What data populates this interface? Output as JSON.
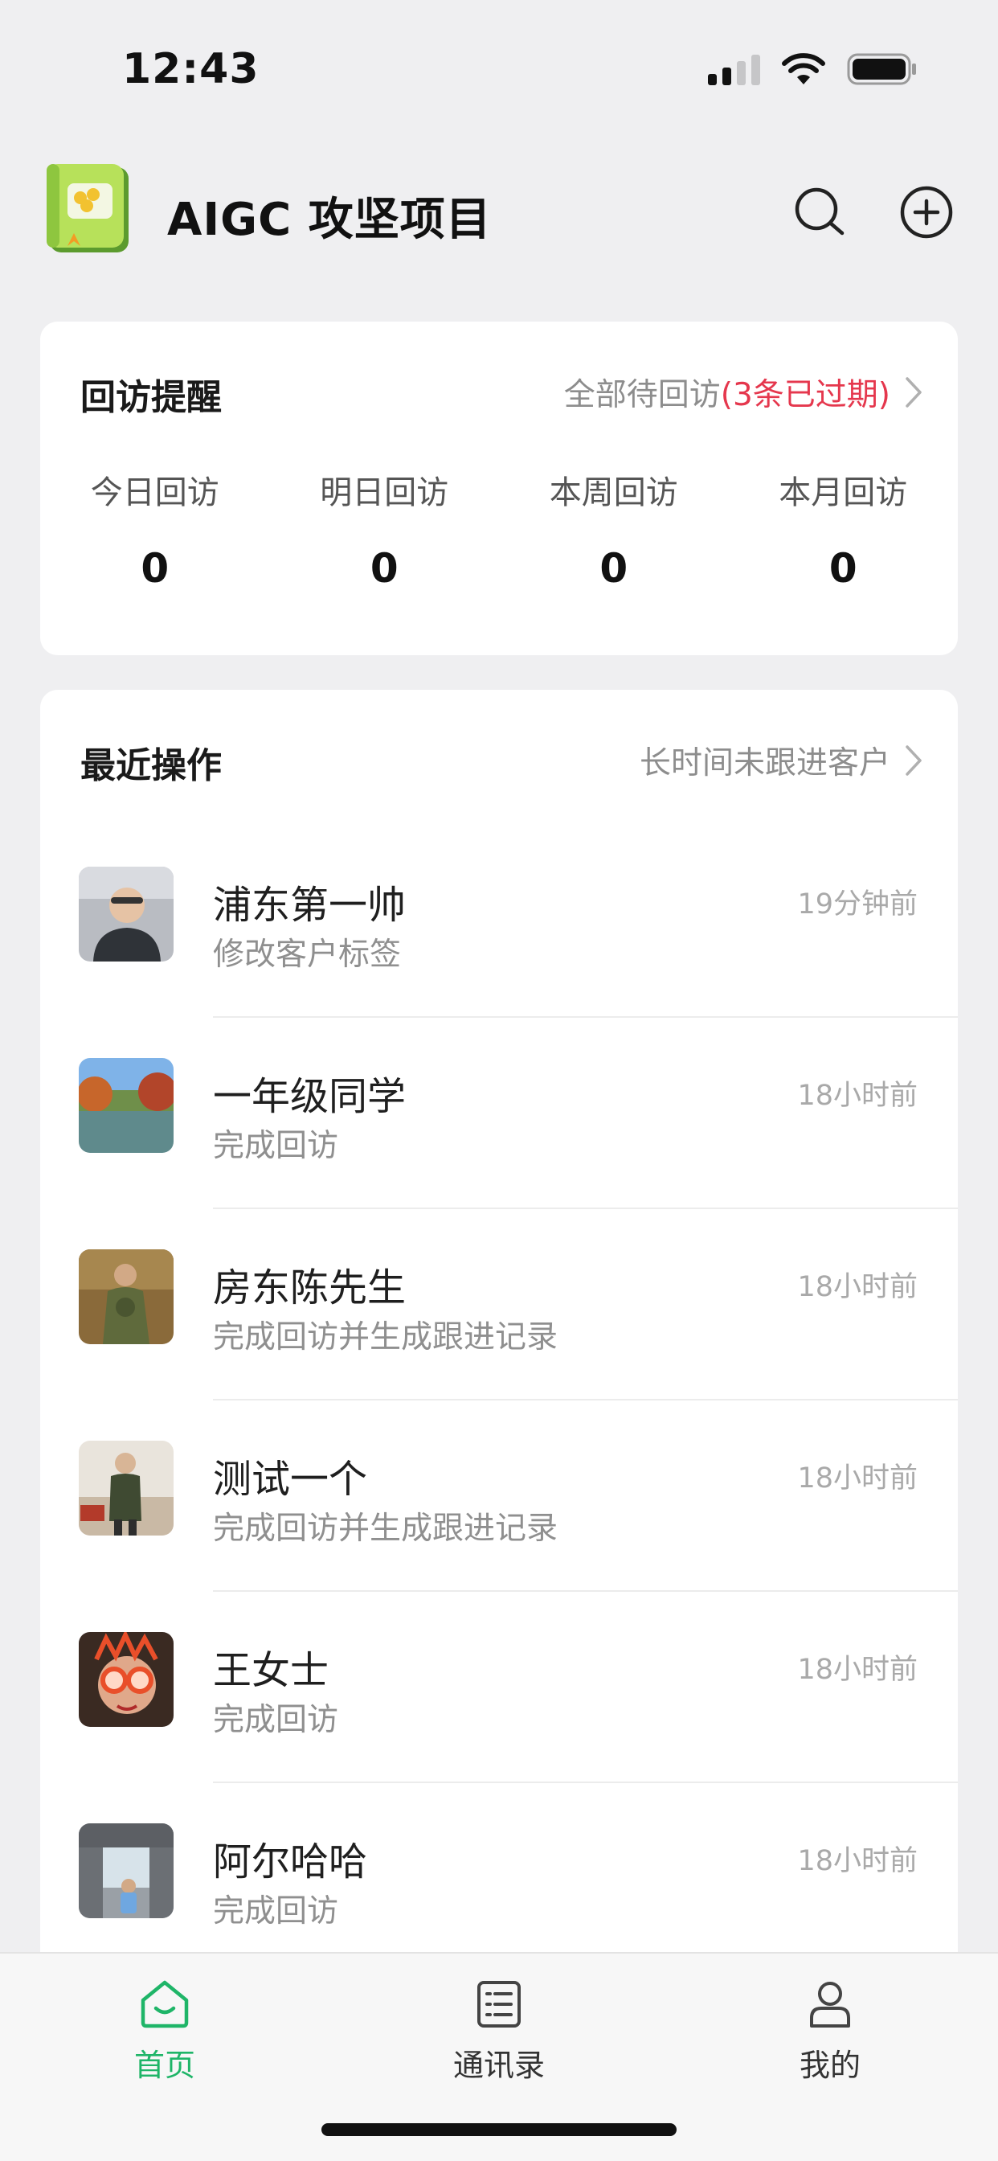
{
  "status_bar": {
    "time": "12:43",
    "icons": [
      "cellular-signal-icon",
      "wifi-icon",
      "battery-icon"
    ]
  },
  "header": {
    "title": "AIGC 攻坚项目",
    "logo_icon": "green-book-logo-icon",
    "search_icon": "search-icon",
    "add_icon": "plus-circle-icon"
  },
  "visits": {
    "title": "回访提醒",
    "link_text": "全部待回访",
    "overdue_text": "(3条已过期)",
    "stats": [
      {
        "label": "今日回访",
        "value": "0"
      },
      {
        "label": "明日回访",
        "value": "0"
      },
      {
        "label": "本周回访",
        "value": "0"
      },
      {
        "label": "本月回访",
        "value": "0"
      }
    ]
  },
  "recent": {
    "title": "最近操作",
    "link_text": "长时间未跟进客户",
    "items": [
      {
        "name": "浦东第一帅",
        "action": "修改客户标签",
        "time": "19分钟前"
      },
      {
        "name": "一年级同学",
        "action": "完成回访",
        "time": "18小时前"
      },
      {
        "name": "房东陈先生",
        "action": "完成回访并生成跟进记录",
        "time": "18小时前"
      },
      {
        "name": "测试一个",
        "action": "完成回访并生成跟进记录",
        "time": "18小时前"
      },
      {
        "name": "王女士",
        "action": "完成回访",
        "time": "18小时前"
      },
      {
        "name": "阿尔哈哈",
        "action": "完成回访",
        "time": "18小时前"
      }
    ]
  },
  "tabbar": {
    "tabs": [
      {
        "label": "首页",
        "icon": "home-icon",
        "active": true
      },
      {
        "label": "通讯录",
        "icon": "contacts-list-icon",
        "active": false
      },
      {
        "label": "我的",
        "icon": "profile-icon",
        "active": false
      }
    ]
  },
  "colors": {
    "accent_green": "#1fb568",
    "overdue_red": "#e5374d",
    "background": "#efeff1"
  }
}
